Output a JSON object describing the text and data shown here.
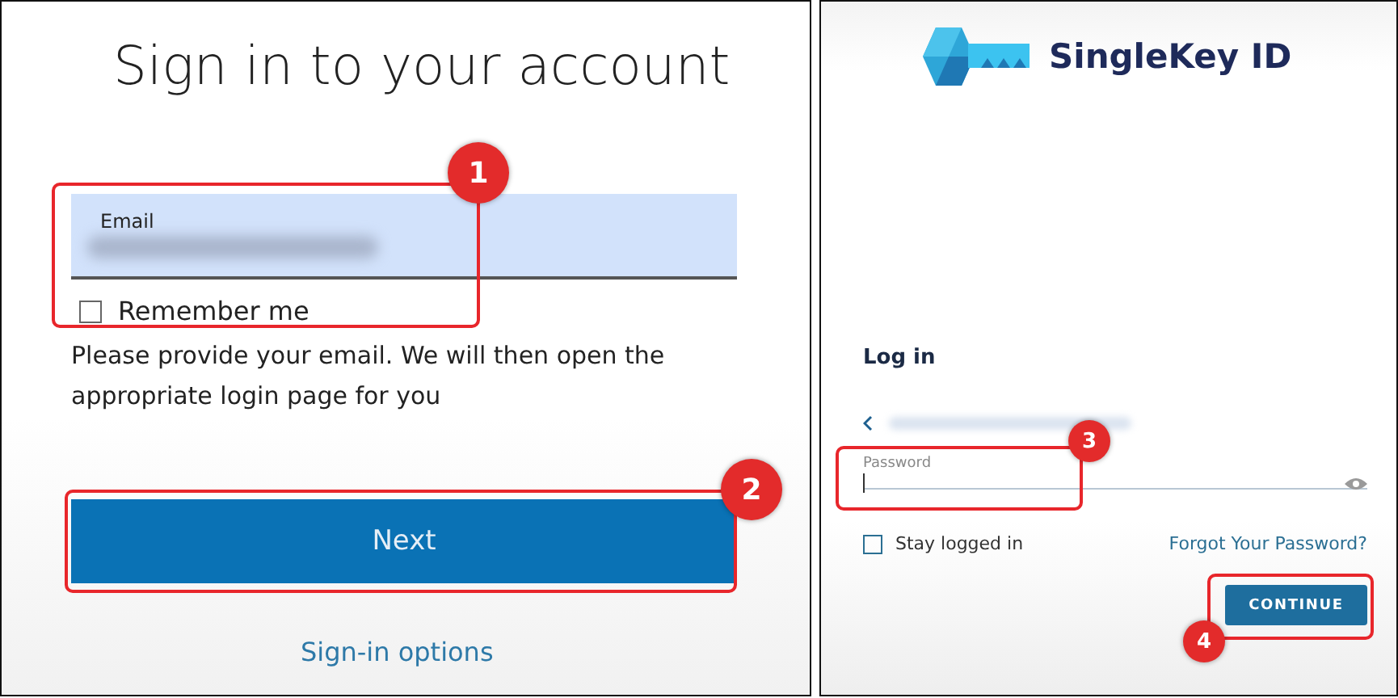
{
  "sign_in": {
    "title": "Sign in to your account",
    "email_field": {
      "label": "Email"
    },
    "remember_me": {
      "label": "Remember me",
      "checked": false
    },
    "hint": "Please provide your email. We will then open the appropriate login page for you",
    "next_button": "Next",
    "options_link": "Sign-in options"
  },
  "login": {
    "logo_text": "SingleKey ID",
    "heading": "Log in",
    "password_field": {
      "label": "Password"
    },
    "stay_logged_in": {
      "label": "Stay logged in",
      "checked": false
    },
    "forgot_link": "Forgot Your Password?",
    "continue_button": "CONTINUE"
  },
  "annotations": [
    {
      "number": "1"
    },
    {
      "number": "2"
    },
    {
      "number": "3"
    },
    {
      "number": "4"
    }
  ]
}
